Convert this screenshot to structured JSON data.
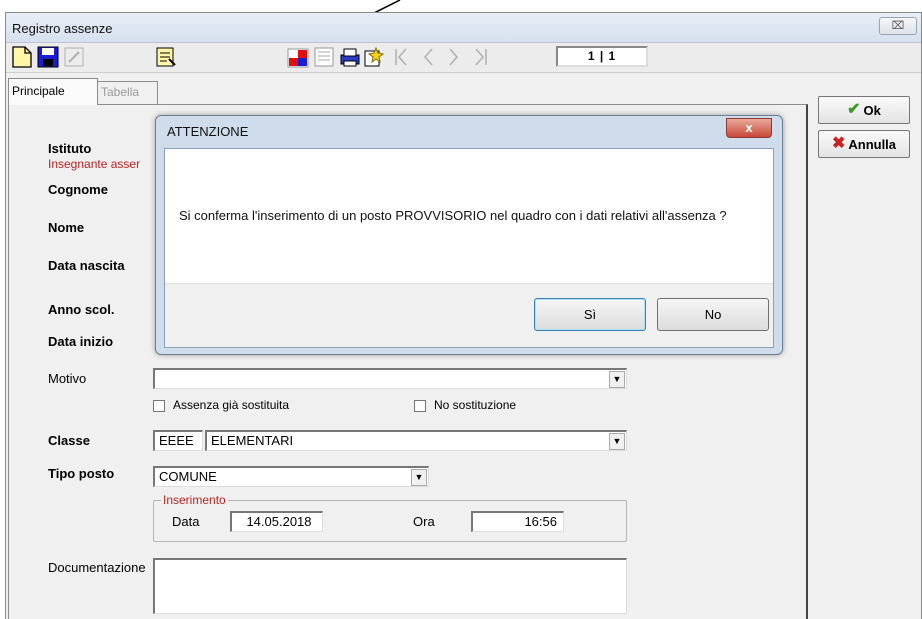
{
  "window": {
    "title": "Registro assenze",
    "close_glyph": "⌧"
  },
  "toolbar": {
    "icons": [
      "new-document-icon",
      "save-icon",
      "edit-disabled-icon",
      "notes-icon",
      "provisional-post-icon",
      "list-icon",
      "print-icon",
      "wizard-icon",
      "first-record-icon",
      "previous-record-icon",
      "next-record-icon",
      "last-record-icon"
    ],
    "record_counter": "1 | 1"
  },
  "tabs": [
    {
      "label": "Principale",
      "active": true
    },
    {
      "label": "Tabella",
      "active": false
    }
  ],
  "form": {
    "istituto_label": "Istituto",
    "insegnante_label": "Insegnante asser",
    "cognome_label": "Cognome",
    "nome_label": "Nome",
    "data_nascita_label": "Data nascita",
    "anno_scol_label": "Anno scol.",
    "data_inizio_label": "Data inizio",
    "motivo_label": "Motivo",
    "motivo_value": "",
    "assenza_sostituita_label": "Assenza già sostituita",
    "no_sostituzione_label": "No sostituzione",
    "classe_label": "Classe",
    "classe_code": "EEEE",
    "classe_value": "ELEMENTARI",
    "tipo_posto_label": "Tipo posto",
    "tipo_posto_value": "COMUNE",
    "inserimento_title": "Inserimento",
    "data_label": "Data",
    "data_value": "14.05.2018",
    "ora_label": "Ora",
    "ora_value": "16:56",
    "documentazione_label": "Documentazione",
    "documentazione_value": ""
  },
  "side_buttons": {
    "ok_label": "Ok",
    "annulla_label": "Annulla"
  },
  "dialog": {
    "title": "ATTENZIONE",
    "message": "Si conferma l'inserimento di un posto PROVVISORIO nel quadro con i dati relativi all'assenza ?",
    "yes_label": "Sì",
    "no_label": "No",
    "close_glyph": "x"
  },
  "colors": {
    "dialog_frame": "#cfdcec",
    "close_red": "#c8483a",
    "group_title_red": "#b22222",
    "ok_green": "#3a9a2a",
    "annulla_red": "#cc2222"
  }
}
